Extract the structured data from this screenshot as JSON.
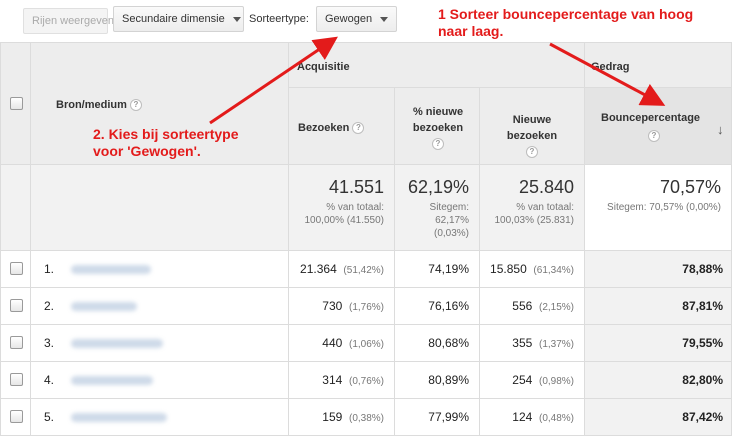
{
  "toolbar": {
    "rows_button": "Rijen weergeven",
    "secondary_dimension": "Secundaire dimensie",
    "sort_type_label": "Sorteertype:",
    "sort_type_value": "Gewogen"
  },
  "table": {
    "dimension_header": "Bron/medium",
    "groups": {
      "acquisition": "Acquisitie",
      "behavior": "Gedrag"
    },
    "columns": {
      "visits": "Bezoeken",
      "pct_new_visits": "% nieuwe bezoeken",
      "new_visits": "Nieuwe bezoeken",
      "bounce_rate": "Bouncepercentage"
    },
    "totals": {
      "visits": "41.551",
      "visits_sub1": "% van totaal:",
      "visits_sub2": "100,00% (41.550)",
      "pct_new": "62,19%",
      "pct_new_sub1": "Sitegem:",
      "pct_new_sub2": "62,17%",
      "pct_new_sub3": "(0,03%)",
      "new_visits": "25.840",
      "new_visits_sub1": "% van totaal:",
      "new_visits_sub2": "100,03% (25.831)",
      "bounce": "70,57%",
      "bounce_sub": "Sitegem: 70,57% (0,00%)"
    },
    "rows": [
      {
        "index": "1.",
        "visits": "21.364",
        "visits_pct": "(51,42%)",
        "pct_new": "74,19%",
        "new_visits": "15.850",
        "new_pct": "(61,34%)",
        "bounce": "78,88%"
      },
      {
        "index": "2.",
        "visits": "730",
        "visits_pct": "(1,76%)",
        "pct_new": "76,16%",
        "new_visits": "556",
        "new_pct": "(2,15%)",
        "bounce": "87,81%"
      },
      {
        "index": "3.",
        "visits": "440",
        "visits_pct": "(1,06%)",
        "pct_new": "80,68%",
        "new_visits": "355",
        "new_pct": "(1,37%)",
        "bounce": "79,55%"
      },
      {
        "index": "4.",
        "visits": "314",
        "visits_pct": "(0,76%)",
        "pct_new": "80,89%",
        "new_visits": "254",
        "new_pct": "(0,98%)",
        "bounce": "82,80%"
      },
      {
        "index": "5.",
        "visits": "159",
        "visits_pct": "(0,38%)",
        "pct_new": "77,99%",
        "new_visits": "124",
        "new_pct": "(0,48%)",
        "bounce": "87,42%"
      }
    ]
  },
  "annotations": {
    "step1_line1": "1 Sorteer bouncepercentage van hoog",
    "step1_line2": "naar laag.",
    "step2_line1": "2. Kies bij sorteertype",
    "step2_line2": "voor 'Gewogen'."
  },
  "colors": {
    "annotation": "#e31b1b",
    "header_bg": "#ededed"
  }
}
